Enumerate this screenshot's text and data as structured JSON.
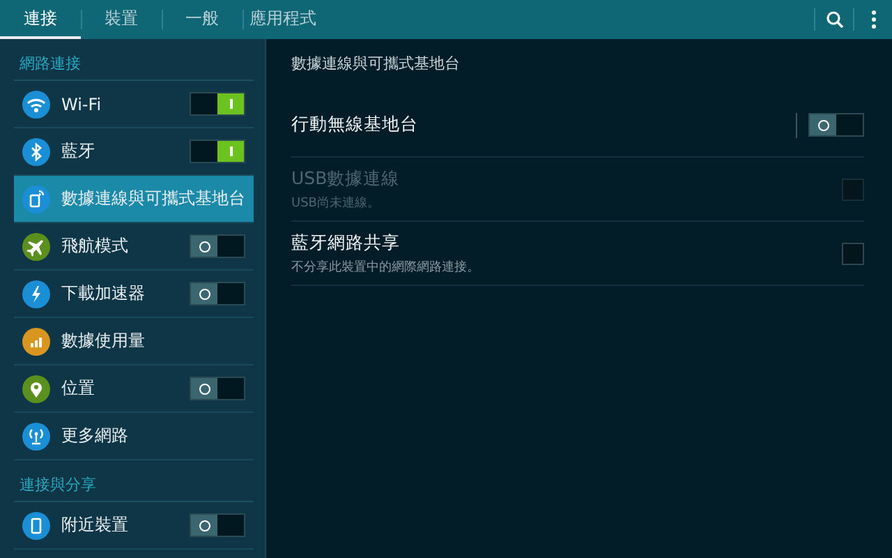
{
  "tabs": [
    {
      "label": "連接",
      "selected": true
    },
    {
      "label": "裝置",
      "selected": false
    },
    {
      "label": "一般",
      "selected": false
    },
    {
      "label": "應用程式",
      "selected": false
    }
  ],
  "sidebar": {
    "sections": [
      {
        "title": "網路連接",
        "items": [
          {
            "label": "Wi-Fi",
            "kind": "toggle",
            "on": true,
            "selected": false
          },
          {
            "label": "藍牙",
            "kind": "toggle",
            "on": true,
            "selected": false
          },
          {
            "label": "數據連線與可攜式基地台",
            "kind": "link",
            "selected": true
          },
          {
            "label": "飛航模式",
            "kind": "toggle",
            "on": false,
            "selected": false
          },
          {
            "label": "下載加速器",
            "kind": "toggle",
            "on": false,
            "selected": false
          },
          {
            "label": "數據使用量",
            "kind": "link",
            "selected": false
          },
          {
            "label": "位置",
            "kind": "toggle",
            "on": false,
            "selected": false
          },
          {
            "label": "更多網路",
            "kind": "link",
            "selected": false
          }
        ]
      },
      {
        "title": "連接與分享",
        "items": [
          {
            "label": "附近裝置",
            "kind": "toggle",
            "on": false,
            "selected": false
          }
        ]
      }
    ]
  },
  "detail": {
    "title": "數據連線與可攜式基地台",
    "rows": [
      {
        "kind": "switch",
        "label": "行動無線基地台",
        "on": false,
        "disabled": false
      },
      {
        "kind": "checkbox",
        "label": "USB數據連線",
        "summary": "USB尚未連線。",
        "checked": false,
        "disabled": true
      },
      {
        "kind": "checkbox",
        "label": "藍牙網路共享",
        "summary": "不分享此裝置中的網際網路連接。",
        "checked": false,
        "disabled": false
      }
    ]
  }
}
